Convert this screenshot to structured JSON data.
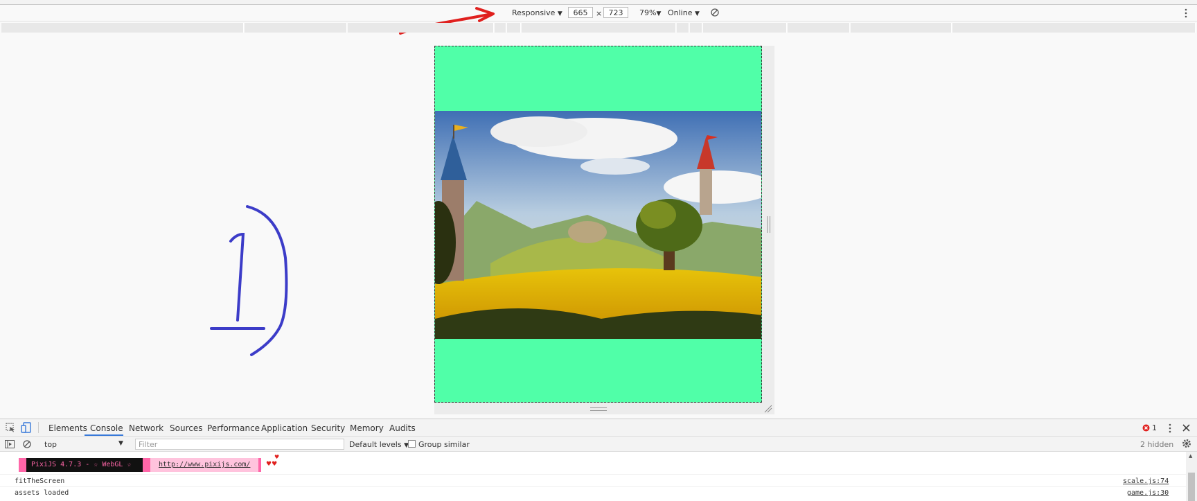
{
  "device_toolbar": {
    "device": "Responsive",
    "width": "665",
    "times": "×",
    "height": "723",
    "zoom": "79%",
    "network": "Online"
  },
  "devtools": {
    "tabs": [
      "Elements",
      "Console",
      "Network",
      "Sources",
      "Performance",
      "Application",
      "Security",
      "Memory",
      "Audits"
    ],
    "active_tab": "Console",
    "error_count": "1"
  },
  "console_toolbar": {
    "context": "top",
    "filter_placeholder": "Filter",
    "levels": "Default levels",
    "group_similar": "Group similar",
    "hidden": "2 hidden"
  },
  "console": {
    "pixi_banner": "PixiJS 4.7.3 - ☆ WebGL ☆",
    "pixi_link": "http://www.pixijs.com/",
    "hearts": "♥♥",
    "heart_top": "♥",
    "messages": [
      {
        "text": "fitTheScreen",
        "source": "scale.js:74"
      },
      {
        "text": "assets loaded",
        "source": "game.js:30"
      }
    ]
  },
  "colors": {
    "canvas_bg": "#50ffa8",
    "annotation_red": "#e0201e",
    "annotation_blue": "#3c3cc8",
    "pixi_pink": "#ff66a8",
    "active_tab_line": "#3879d9"
  }
}
